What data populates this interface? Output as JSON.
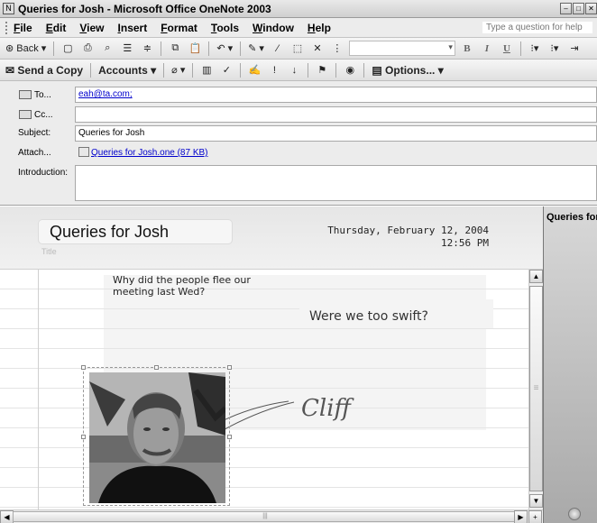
{
  "window": {
    "title": "Queries for Josh - Microsoft Office OneNote 2003",
    "help_placeholder": "Type a question for help"
  },
  "menu": [
    "File",
    "Edit",
    "View",
    "Insert",
    "Format",
    "Tools",
    "Window",
    "Help"
  ],
  "toolbar": {
    "back_label": "Back",
    "send_copy_label": "Send a Copy",
    "accounts_label": "Accounts",
    "options_label": "Options..."
  },
  "email": {
    "to_label": "To...",
    "to_value": "eah@ta.com;",
    "cc_label": "Cc...",
    "cc_value": "",
    "subject_label": "Subject:",
    "subject_value": "Queries for Josh",
    "attach_label": "Attach...",
    "attach_value": "Queries for Josh.one (87 KB)",
    "intro_label": "Introduction:",
    "intro_value": ""
  },
  "page": {
    "title": "Queries for Josh",
    "title_hint": "Title",
    "date": "Thursday, February 12, 2004",
    "time": "12:56 PM",
    "note_line1": "Why did the people flee our",
    "note_line2": "meeting last Wed?",
    "note_swift": "Were we too swift?",
    "handwriting": "Cliff"
  },
  "side_panel": {
    "tab_label": "Queries for Josh"
  }
}
